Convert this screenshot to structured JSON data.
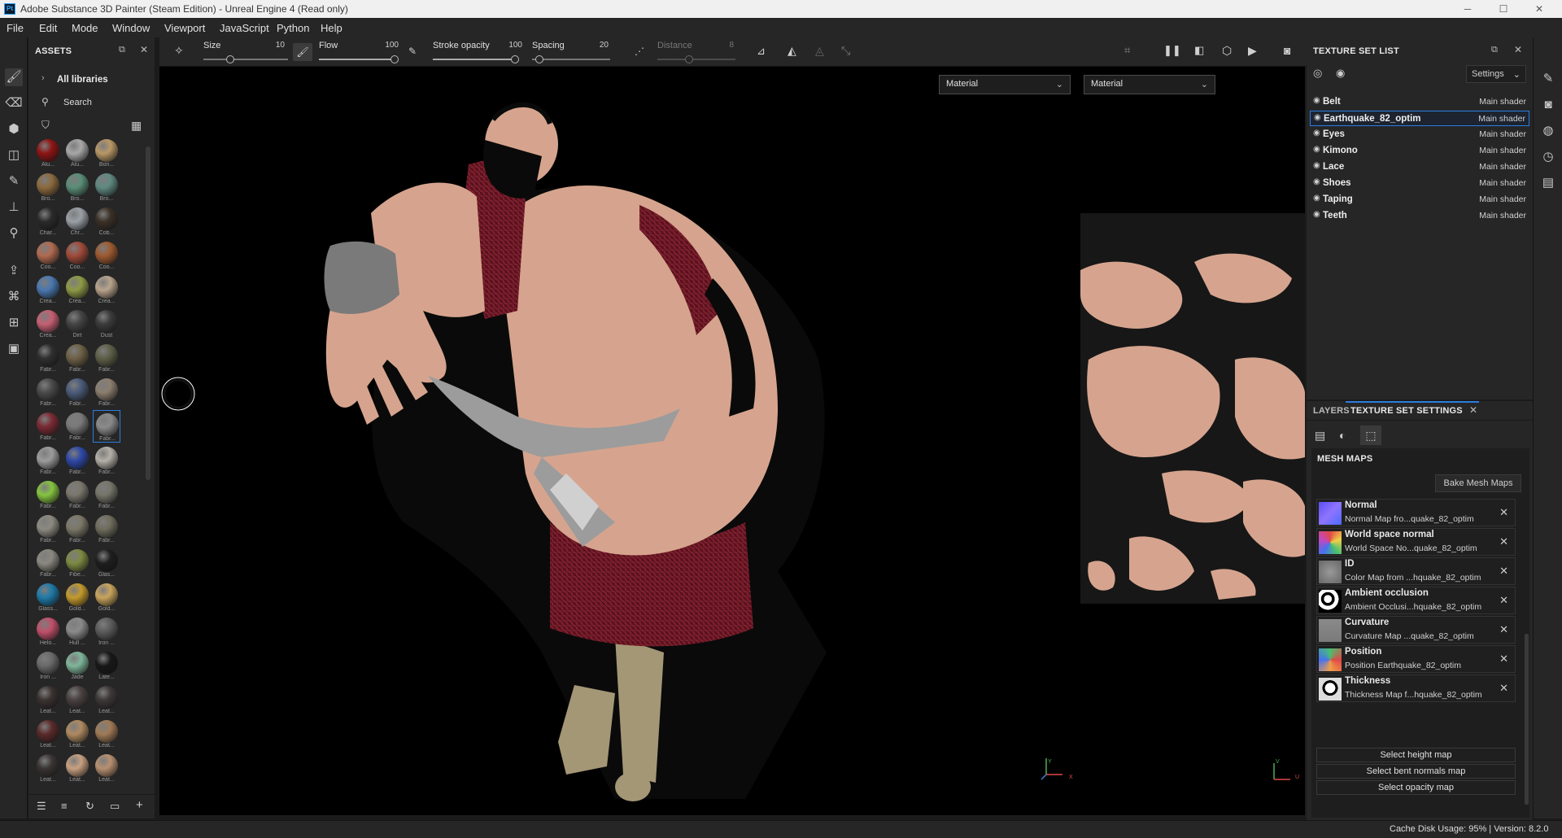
{
  "window": {
    "app_badge": "Pt",
    "title": "Adobe Substance 3D Painter (Steam Edition) - Unreal Engine 4 (Read only)",
    "minimize": "─",
    "maximize": "☐",
    "close": "✕"
  },
  "menubar": [
    "File",
    "Edit",
    "Mode",
    "Window",
    "Viewport",
    "JavaScript",
    "Python",
    "Help"
  ],
  "assets": {
    "title": "ASSETS",
    "all_libraries": "All libraries",
    "search_placeholder": "Search",
    "materials": [
      {
        "label": "Alu...",
        "color": "#8e1414"
      },
      {
        "label": "Alu...",
        "color": "#a8a8a8"
      },
      {
        "label": "Bon...",
        "color": "#b99865"
      },
      {
        "label": "Bro...",
        "color": "#8c6a3e"
      },
      {
        "label": "Bro...",
        "color": "#5a8e77"
      },
      {
        "label": "Bro...",
        "color": "#5f8a80"
      },
      {
        "label": "Char...",
        "color": "#2a2a2a"
      },
      {
        "label": "Chr...",
        "color": "#9aa0a6"
      },
      {
        "label": "Cob...",
        "color": "#3a3027"
      },
      {
        "label": "Coo...",
        "color": "#b06a50"
      },
      {
        "label": "Coo...",
        "color": "#a04a3a"
      },
      {
        "label": "Coo...",
        "color": "#9e5a30"
      },
      {
        "label": "Crea...",
        "color": "#4a78b0"
      },
      {
        "label": "Crea...",
        "color": "#8f9a45"
      },
      {
        "label": "Crea...",
        "color": "#b9a38c"
      },
      {
        "label": "Crea...",
        "color": "#c56073"
      },
      {
        "label": "Dirt",
        "color": "#444444"
      },
      {
        "label": "Dust",
        "color": "#3b3b3b"
      },
      {
        "label": "Fabr...",
        "color": "#2f2f2f"
      },
      {
        "label": "Fabr...",
        "color": "#6e6146"
      },
      {
        "label": "Fabr...",
        "color": "#5f6048"
      },
      {
        "label": "Fabr...",
        "color": "#4a4a4a"
      },
      {
        "label": "Fabr...",
        "color": "#4b5b7a"
      },
      {
        "label": "Fabr...",
        "color": "#8b7e6e"
      },
      {
        "label": "Fabr...",
        "color": "#7a2a34"
      },
      {
        "label": "Fabr...",
        "color": "#7a7a7a"
      },
      {
        "label": "Fabr...",
        "color": "#8a8a8a"
      },
      {
        "label": "Fabr...",
        "color": "#9c9c9c"
      },
      {
        "label": "Fabr...",
        "color": "#2e48a6"
      },
      {
        "label": "Fabr...",
        "color": "#b4b0a8"
      },
      {
        "label": "Fabr...",
        "color": "#85c440"
      },
      {
        "label": "Fabr...",
        "color": "#7a776c"
      },
      {
        "label": "Fabr...",
        "color": "#76756a"
      },
      {
        "label": "Fabr...",
        "color": "#8c8a80"
      },
      {
        "label": "Fabr...",
        "color": "#7b7868"
      },
      {
        "label": "Fabr...",
        "color": "#6f6d5c"
      },
      {
        "label": "Fabr...",
        "color": "#8a8880"
      },
      {
        "label": "Fibe...",
        "color": "#7d8a42"
      },
      {
        "label": "Glas...",
        "color": "#1e1e1e"
      },
      {
        "label": "Glass...",
        "color": "#1e7aa8"
      },
      {
        "label": "Gold...",
        "color": "#c49a2c"
      },
      {
        "label": "Gold...",
        "color": "#c9a45c"
      },
      {
        "label": "Helo...",
        "color": "#c0506a"
      },
      {
        "label": "Hull ...",
        "color": "#8a8a8a"
      },
      {
        "label": "Iron ...",
        "color": "#5c5c5c"
      },
      {
        "label": "Iron ...",
        "color": "#6a6a6a"
      },
      {
        "label": "Jade",
        "color": "#7fb69a"
      },
      {
        "label": "Late...",
        "color": "#181818"
      },
      {
        "label": "Leat...",
        "color": "#3a3230"
      },
      {
        "label": "Leat...",
        "color": "#4a4040"
      },
      {
        "label": "Leat...",
        "color": "#3e3838"
      },
      {
        "label": "Leat...",
        "color": "#5a2a2a"
      },
      {
        "label": "Leat...",
        "color": "#b08a60"
      },
      {
        "label": "Leat...",
        "color": "#a07a55"
      },
      {
        "label": "Leat...",
        "color": "#3a3434"
      },
      {
        "label": "Leat...",
        "color": "#c8a080"
      },
      {
        "label": "Leat...",
        "color": "#b89070"
      }
    ]
  },
  "tool_options": {
    "size_label": "Size",
    "size_value": "10",
    "flow_label": "Flow",
    "flow_value": "100",
    "stroke_opacity_label": "Stroke opacity",
    "stroke_opacity_value": "100",
    "spacing_label": "Spacing",
    "spacing_value": "20",
    "distance_label": "Distance",
    "distance_value": "8"
  },
  "viewport": {
    "material_select_3d": "Material",
    "material_select_2d": "Material",
    "axis_x": "X",
    "axis_y": "Y",
    "axis_u": "U",
    "axis_v": "V"
  },
  "texture_set_list": {
    "title": "TEXTURE SET LIST",
    "settings_label": "Settings",
    "sets": [
      {
        "name": "Belt",
        "shader": "Main shader"
      },
      {
        "name": "Earthquake_82_optim",
        "shader": "Main shader"
      },
      {
        "name": "Eyes",
        "shader": "Main shader"
      },
      {
        "name": "Kimono",
        "shader": "Main shader"
      },
      {
        "name": "Lace",
        "shader": "Main shader"
      },
      {
        "name": "Shoes",
        "shader": "Main shader"
      },
      {
        "name": "Taping",
        "shader": "Main shader"
      },
      {
        "name": "Teeth",
        "shader": "Main shader"
      }
    ]
  },
  "tss": {
    "tab_layers": "LAYERS",
    "tab_tss": "TEXTURE SET SETTINGS",
    "mesh_maps_title": "MESH MAPS",
    "bake_button": "Bake Mesh Maps",
    "maps": [
      {
        "name": "Normal",
        "desc": "Normal Map fro...quake_82_optim"
      },
      {
        "name": "World space normal",
        "desc": "World Space No...quake_82_optim"
      },
      {
        "name": "ID",
        "desc": "Color Map from ...hquake_82_optim"
      },
      {
        "name": "Ambient occlusion",
        "desc": "Ambient Occlusi...hquake_82_optim"
      },
      {
        "name": "Curvature",
        "desc": "Curvature Map ...quake_82_optim"
      },
      {
        "name": "Position",
        "desc": "Position Earthquake_82_optim"
      },
      {
        "name": "Thickness",
        "desc": "Thickness Map f...hquake_82_optim"
      }
    ],
    "select_height": "Select height map",
    "select_bent": "Select bent normals map",
    "select_opacity": "Select opacity map"
  },
  "status": {
    "cache": "Cache Disk Usage:   95% | Version: 8.2.0"
  }
}
